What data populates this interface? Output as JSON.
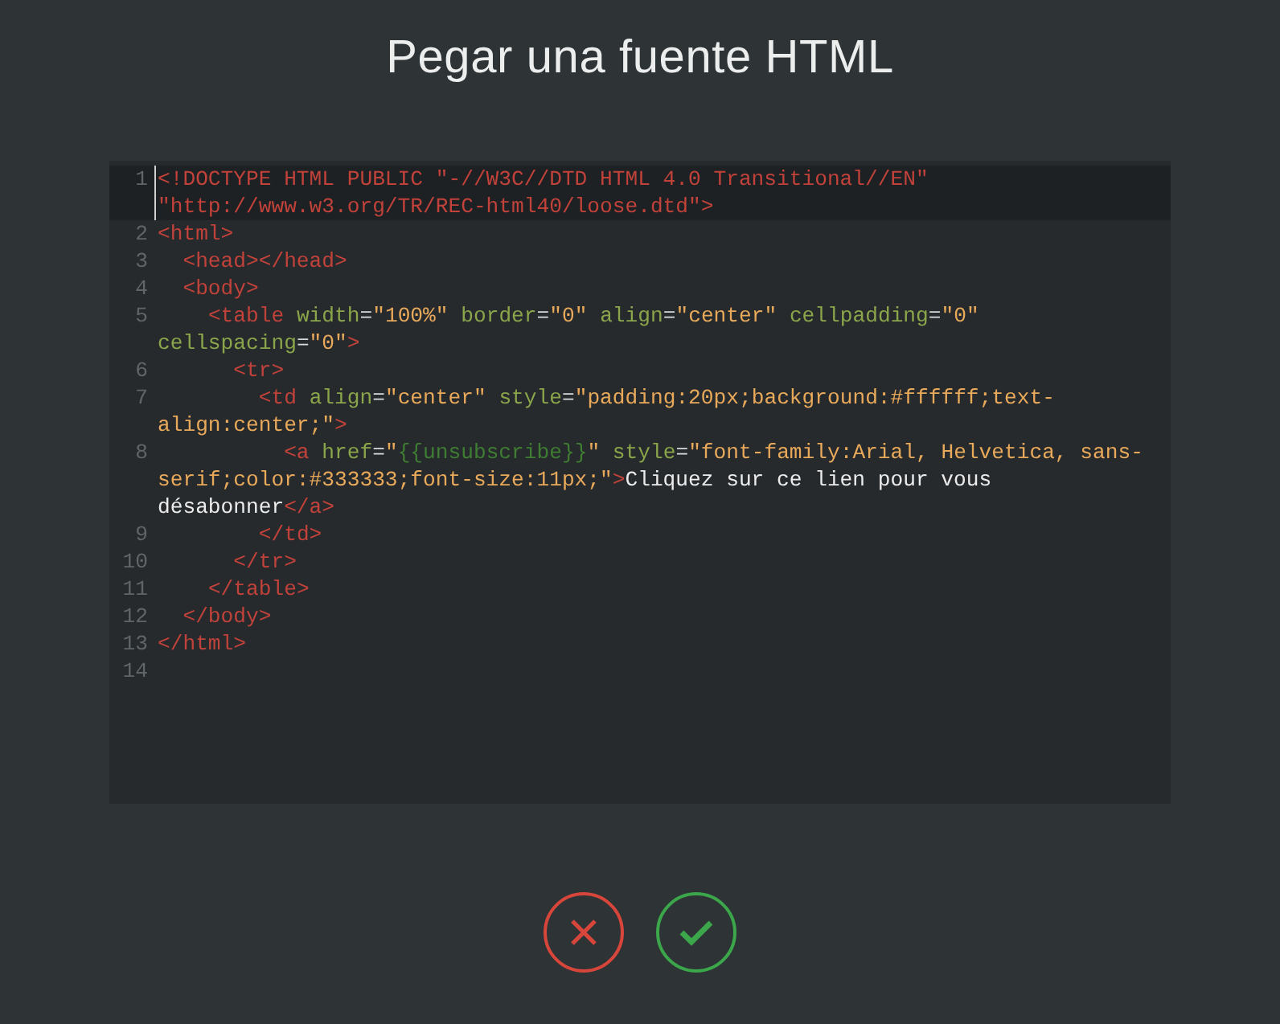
{
  "title": "Pegar una fuente HTML",
  "editor": {
    "lines": [
      {
        "number": "1",
        "active": true,
        "tokens": [
          {
            "kind": "tag",
            "text": "<!DOCTYPE HTML PUBLIC \"-//W3C//DTD HTML 4.0 Transitional//EN\" \"http://www.w3.org/TR/REC-html40/loose.dtd\">"
          }
        ]
      },
      {
        "number": "2",
        "active": false,
        "tokens": [
          {
            "kind": "tag",
            "text": "<html>"
          }
        ]
      },
      {
        "number": "3",
        "active": false,
        "tokens": [
          {
            "kind": "tag",
            "text": "  <head></head>"
          }
        ]
      },
      {
        "number": "4",
        "active": false,
        "tokens": [
          {
            "kind": "tag",
            "text": "  <body>"
          }
        ]
      },
      {
        "number": "5",
        "active": false,
        "tokens": [
          {
            "kind": "tag",
            "text": "    <table "
          },
          {
            "kind": "attr",
            "text": "width"
          },
          {
            "kind": "punct",
            "text": "="
          },
          {
            "kind": "value",
            "text": "\"100%\" "
          },
          {
            "kind": "attr",
            "text": "border"
          },
          {
            "kind": "punct",
            "text": "="
          },
          {
            "kind": "value",
            "text": "\"0\" "
          },
          {
            "kind": "attr",
            "text": "align"
          },
          {
            "kind": "punct",
            "text": "="
          },
          {
            "kind": "value",
            "text": "\"center\" "
          },
          {
            "kind": "attr",
            "text": "cellpadding"
          },
          {
            "kind": "punct",
            "text": "="
          },
          {
            "kind": "value",
            "text": "\"0\" "
          },
          {
            "kind": "attr",
            "text": "cellspacing"
          },
          {
            "kind": "punct",
            "text": "="
          },
          {
            "kind": "value",
            "text": "\"0\""
          },
          {
            "kind": "tag",
            "text": ">"
          }
        ]
      },
      {
        "number": "6",
        "active": false,
        "tokens": [
          {
            "kind": "tag",
            "text": "      <tr>"
          }
        ]
      },
      {
        "number": "7",
        "active": false,
        "tokens": [
          {
            "kind": "tag",
            "text": "        <td "
          },
          {
            "kind": "attr",
            "text": "align"
          },
          {
            "kind": "punct",
            "text": "="
          },
          {
            "kind": "value",
            "text": "\"center\" "
          },
          {
            "kind": "attr",
            "text": "style"
          },
          {
            "kind": "punct",
            "text": "="
          },
          {
            "kind": "value",
            "text": "\"padding:20px;background:#ffffff;text-align:center;\""
          },
          {
            "kind": "tag",
            "text": ">"
          }
        ]
      },
      {
        "number": "8",
        "active": false,
        "tokens": [
          {
            "kind": "tag",
            "text": "          <a "
          },
          {
            "kind": "attr",
            "text": "href"
          },
          {
            "kind": "punct",
            "text": "="
          },
          {
            "kind": "value",
            "text": "\""
          },
          {
            "kind": "template",
            "text": "{{unsubscribe}}"
          },
          {
            "kind": "value",
            "text": "\" "
          },
          {
            "kind": "attr",
            "text": "style"
          },
          {
            "kind": "punct",
            "text": "="
          },
          {
            "kind": "value",
            "text": "\"font-family:Arial, Helvetica, sans-serif;color:#333333;font-size:11px;\""
          },
          {
            "kind": "tag",
            "text": ">"
          },
          {
            "kind": "text",
            "text": "Cliquez sur ce lien pour vous désabonner"
          },
          {
            "kind": "tag",
            "text": "</a>"
          }
        ]
      },
      {
        "number": "9",
        "active": false,
        "tokens": [
          {
            "kind": "tag",
            "text": "        </td>"
          }
        ]
      },
      {
        "number": "10",
        "active": false,
        "tokens": [
          {
            "kind": "tag",
            "text": "      </tr>"
          }
        ]
      },
      {
        "number": "11",
        "active": false,
        "tokens": [
          {
            "kind": "tag",
            "text": "    </table>"
          }
        ]
      },
      {
        "number": "12",
        "active": false,
        "tokens": [
          {
            "kind": "tag",
            "text": "  </body>"
          }
        ]
      },
      {
        "number": "13",
        "active": false,
        "tokens": [
          {
            "kind": "tag",
            "text": "</html>"
          }
        ]
      },
      {
        "number": "14",
        "active": false
      }
    ]
  },
  "buttons": [
    {
      "kind": "cancel"
    },
    {
      "kind": "confirm"
    }
  ]
}
